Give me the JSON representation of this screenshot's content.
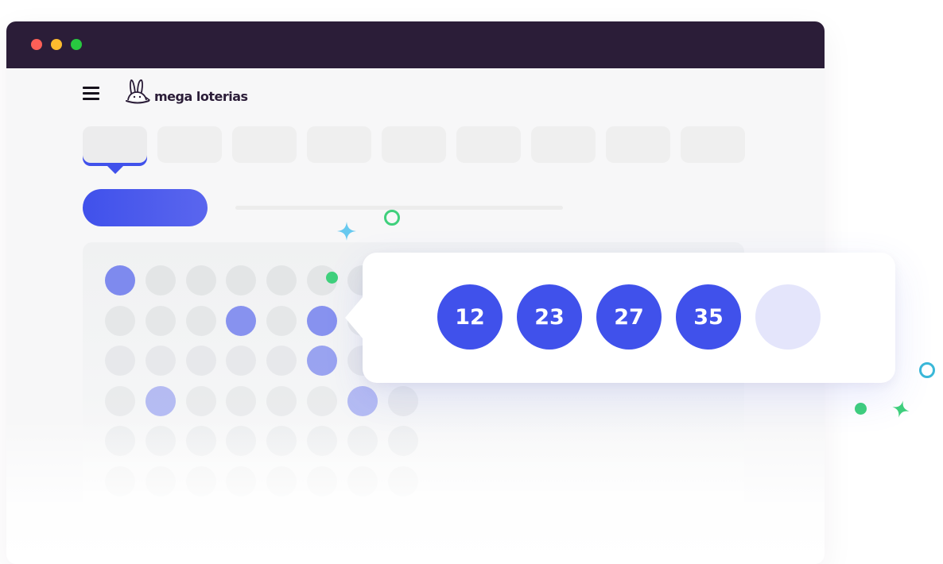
{
  "colors": {
    "titlebar": "#2b1d38",
    "accent": "#4051eb",
    "traffic_red": "#fe5f57",
    "traffic_yellow": "#febc2e",
    "traffic_green": "#28c840",
    "deco_green": "#3fd07c",
    "deco_cyan": "#3ab8d8",
    "deco_sky": "#67c9ef",
    "empty_ball": "#e4e5fb"
  },
  "logo": {
    "text": "mega loterias"
  },
  "nav": {
    "menu_icon": "hamburger-menu-icon"
  },
  "tabs": {
    "count": 9,
    "active_index": 0
  },
  "number_grid": {
    "rows": 6,
    "cols": 8,
    "marked": [
      {
        "row": 0,
        "col": 0,
        "strength": 0.65
      },
      {
        "row": 1,
        "col": 3,
        "strength": 0.6
      },
      {
        "row": 1,
        "col": 5,
        "strength": 0.6
      },
      {
        "row": 2,
        "col": 5,
        "strength": 0.5
      },
      {
        "row": 3,
        "col": 1,
        "strength": 0.35
      },
      {
        "row": 3,
        "col": 6,
        "strength": 0.35
      }
    ]
  },
  "results": {
    "balls": [
      "12",
      "23",
      "27",
      "35"
    ],
    "empty_slots": 1
  }
}
